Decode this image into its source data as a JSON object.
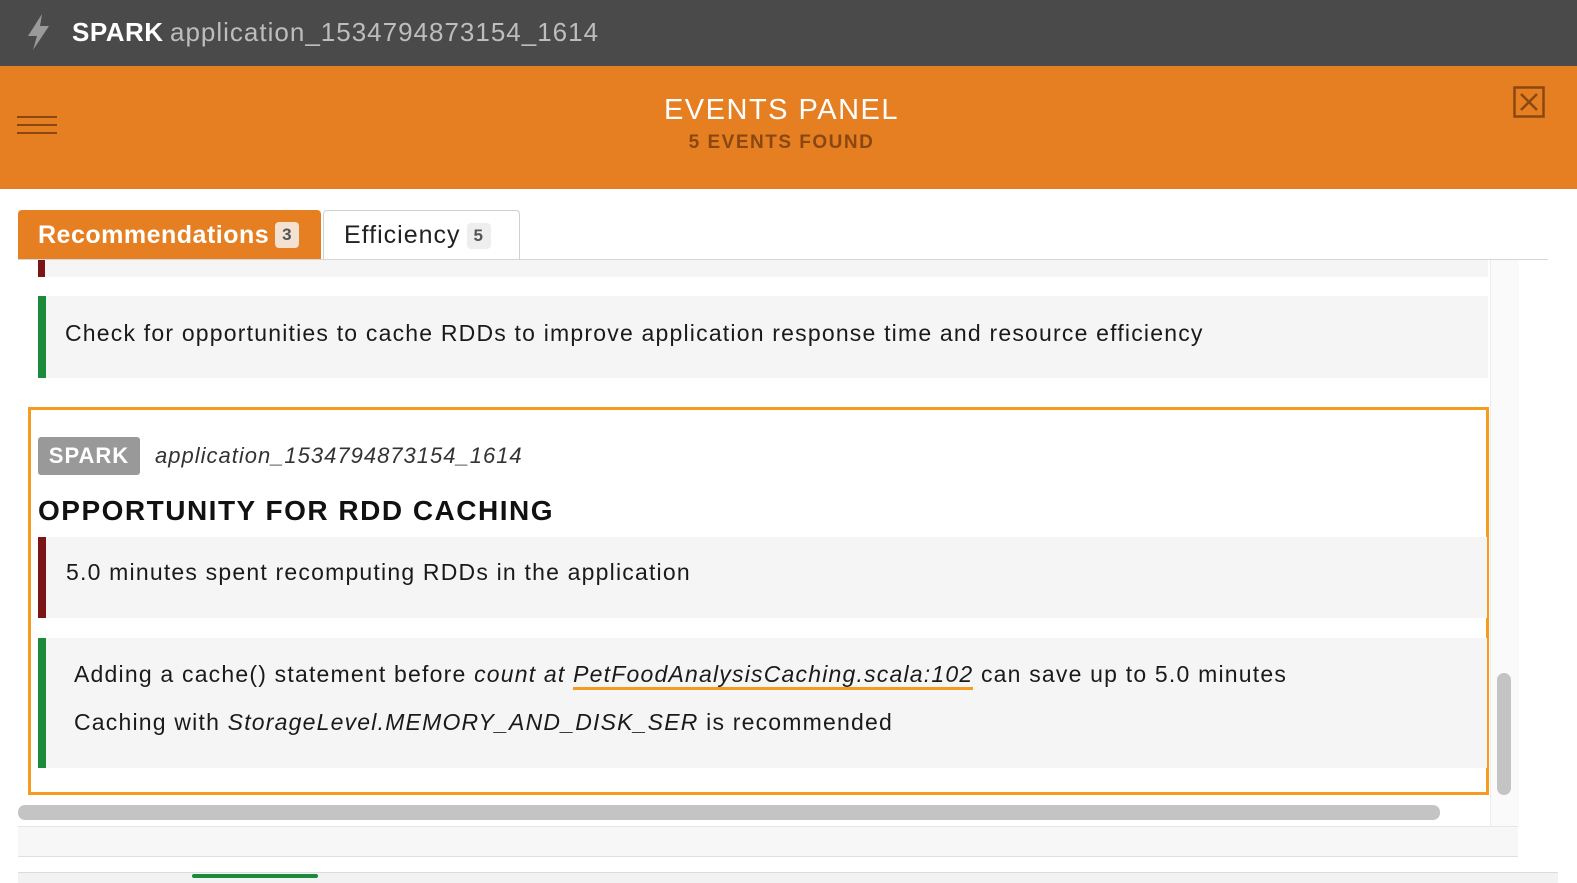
{
  "appbar": {
    "brand": "SPARK",
    "app_id": "application_1534794873154_1614",
    "logo_icon": "spark-lightning-icon"
  },
  "header": {
    "title": "EVENTS PANEL",
    "subtitle": "5 EVENTS FOUND",
    "menu_icon": "hamburger-menu-icon",
    "close_icon": "close-icon"
  },
  "tabs": [
    {
      "label": "Recommendations",
      "count": "3",
      "active": true
    },
    {
      "label": "Efficiency",
      "count": "5",
      "active": false
    }
  ],
  "recommendation": {
    "text": "Check for opportunities to cache RDDs to improve application response time and resource efficiency"
  },
  "event": {
    "badge": "SPARK",
    "app_id": "application_1534794873154_1614",
    "title": "OPPORTUNITY FOR RDD CACHING",
    "issue": "5.0 minutes spent recomputing RDDs in the application",
    "advice_prefix": "Adding a cache() statement before",
    "advice_location_prefix": "count at",
    "advice_link": "PetFoodAnalysisCaching.scala:102",
    "advice_suffix": "can save up to 5.0 minutes",
    "caching_prefix": "Caching with",
    "caching_level": "StorageLevel.MEMORY_AND_DISK_SER",
    "caching_suffix": "is recommended"
  },
  "colors": {
    "accent": "#e67f22",
    "highlight_border": "#f39c1f",
    "topbar": "#4a4a4a",
    "severity_high": "#7b1414",
    "severity_ok": "#1b8a3a"
  }
}
